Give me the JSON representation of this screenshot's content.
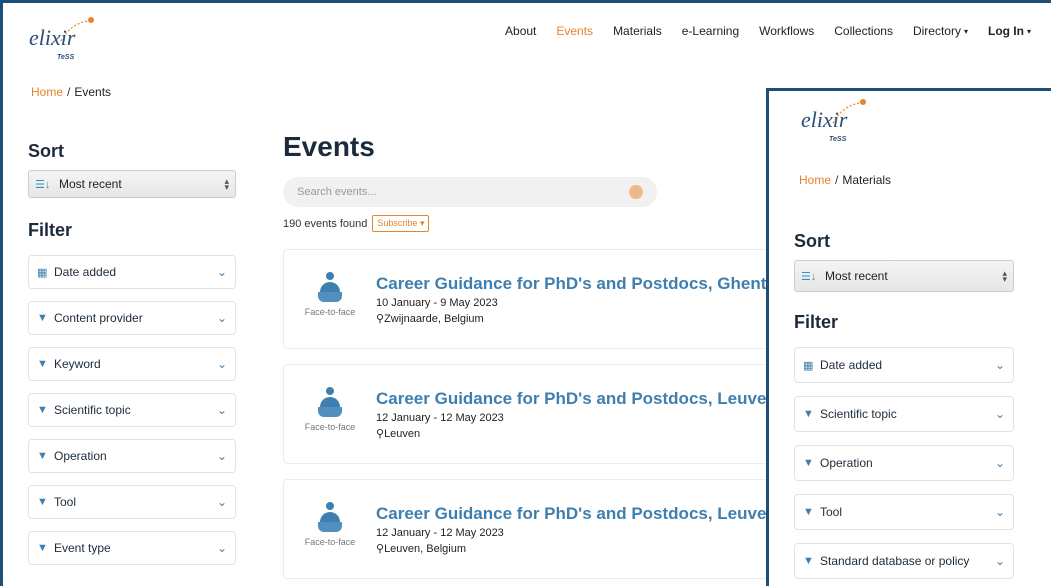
{
  "header": {
    "logo_text": "elixir",
    "logo_sub": "TeSS",
    "nav": [
      {
        "label": "About",
        "active": false
      },
      {
        "label": "Events",
        "active": true
      },
      {
        "label": "Materials",
        "active": false
      },
      {
        "label": "e-Learning",
        "active": false
      },
      {
        "label": "Workflows",
        "active": false
      },
      {
        "label": "Collections",
        "active": false
      },
      {
        "label": "Directory",
        "active": false,
        "dropdown": true
      },
      {
        "label": "Log In",
        "active": false,
        "dropdown": true,
        "bold": true
      }
    ]
  },
  "breadcrumb": {
    "home": "Home",
    "sep": "/",
    "current": "Events"
  },
  "sidebar": {
    "sort_heading": "Sort",
    "sort_value": "Most recent",
    "filter_heading": "Filter",
    "facets": [
      {
        "label": "Date added",
        "icon": "calendar-icon"
      },
      {
        "label": "Content provider",
        "icon": "filter-icon"
      },
      {
        "label": "Keyword",
        "icon": "filter-icon"
      },
      {
        "label": "Scientific topic",
        "icon": "filter-icon"
      },
      {
        "label": "Operation",
        "icon": "filter-icon"
      },
      {
        "label": "Tool",
        "icon": "filter-icon"
      },
      {
        "label": "Event type",
        "icon": "filter-icon"
      }
    ]
  },
  "main": {
    "title": "Events",
    "search_placeholder": "Search events...",
    "results_count": "190 events found",
    "subscribe_label": "Subscribe"
  },
  "events": [
    {
      "title": "Career Guidance for PhD's and Postdocs, Ghent",
      "mode": "Face-to-face",
      "date": "10 January - 9 May 2023",
      "location": "Zwijnaarde, Belgium"
    },
    {
      "title": "Career Guidance for PhD's and Postdocs, Leuven",
      "mode": "Face-to-face",
      "date": "12 January - 12 May 2023",
      "location": "Leuven"
    },
    {
      "title": "Career Guidance for PhD's and Postdocs, Leuven",
      "mode": "Face-to-face",
      "date": "12 January - 12 May 2023",
      "location": "Leuven, Belgium"
    }
  ],
  "overlay": {
    "logo_text": "elixir",
    "logo_sub": "TeSS",
    "breadcrumb": {
      "home": "Home",
      "sep": "/",
      "current": "Materials"
    },
    "sort_heading": "Sort",
    "sort_value": "Most recent",
    "filter_heading": "Filter",
    "facets": [
      {
        "label": "Date added",
        "icon": "calendar-icon"
      },
      {
        "label": "Scientific topic",
        "icon": "filter-icon"
      },
      {
        "label": "Operation",
        "icon": "filter-icon"
      },
      {
        "label": "Tool",
        "icon": "filter-icon"
      },
      {
        "label": "Standard database or policy",
        "icon": "filter-icon"
      }
    ]
  },
  "colors": {
    "accent": "#e5852b",
    "link": "#3f7fb0",
    "frame": "#1f4e79",
    "heading": "#1c2b3a"
  }
}
